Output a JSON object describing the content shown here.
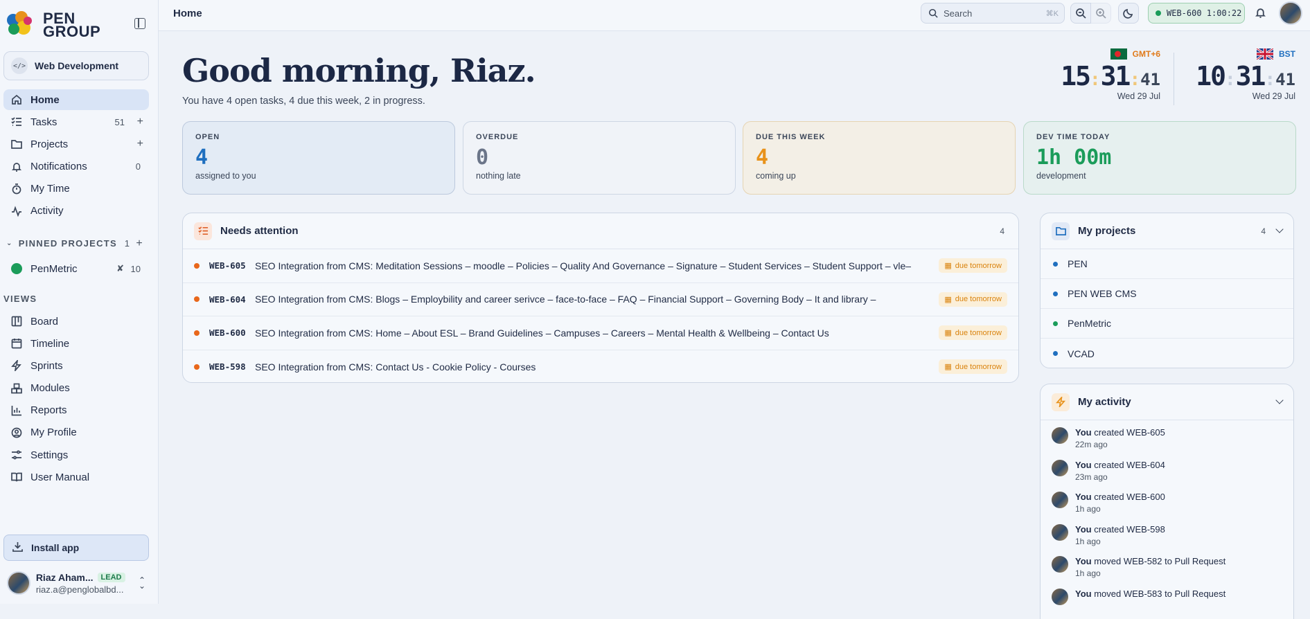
{
  "brand": {
    "line1": "PEN",
    "line2": "GROUP"
  },
  "workspace": {
    "label": "Web Development",
    "icon": "code-icon"
  },
  "nav": {
    "home": "Home",
    "tasks": "Tasks",
    "tasks_count": "51",
    "projects": "Projects",
    "notifications": "Notifications",
    "notifications_count": "0",
    "my_time": "My Time",
    "activity": "Activity"
  },
  "pinned": {
    "heading": "PINNED PROJECTS",
    "count": "1",
    "project": "PenMetric",
    "project_count": "10",
    "project_color": "#1b9c5a"
  },
  "views": {
    "heading": "VIEWS",
    "items": [
      "Board",
      "Timeline",
      "Sprints",
      "Modules",
      "Reports",
      "My Profile",
      "Settings",
      "User Manual"
    ]
  },
  "install": {
    "label": "Install app"
  },
  "user": {
    "name": "Riaz Aham...",
    "badge": "LEAD",
    "email": "riaz.a@penglobalbd..."
  },
  "topbar": {
    "breadcrumb": "Home",
    "search_placeholder": "Search",
    "search_shortcut": "⌘K",
    "timer_label": "WEB-600 1:00:22"
  },
  "greeting": {
    "title": "Good morning, Riaz.",
    "subtitle": "You have 4 open tasks, 4 due this week, 2 in progress."
  },
  "clocks": [
    {
      "tz": "GMT+6",
      "hh": "15",
      "mm": "31",
      "ss": "41",
      "date": "Wed 29 Jul",
      "tz_color": "#e07a1a"
    },
    {
      "tz": "BST",
      "hh": "10",
      "mm": "31",
      "ss": "41",
      "date": "Wed 29 Jul",
      "tz_color": "#1f6fbf"
    }
  ],
  "stats": [
    {
      "label": "OPEN",
      "value": "4",
      "note": "assigned to you",
      "color": "#1f6fbf"
    },
    {
      "label": "OVERDUE",
      "value": "0",
      "note": "nothing late",
      "color": "#6b7589"
    },
    {
      "label": "DUE THIS WEEK",
      "value": "4",
      "note": "coming up",
      "color": "#e8921b"
    },
    {
      "label": "DEV TIME TODAY",
      "value": "1h 00m",
      "note": "development",
      "color": "#1b9c5a"
    }
  ],
  "attention": {
    "title": "Needs attention",
    "count": "4",
    "rows": [
      {
        "key": "WEB-605",
        "title": "SEO Integration from CMS: Meditation Sessions – moodle – Policies – Quality And Governance – Signature – Student Services – Student Support – vle–",
        "due": "due tomorrow"
      },
      {
        "key": "WEB-604",
        "title": "SEO Integration from CMS: Blogs – Employbility and career serivce – face-to-face – FAQ – Financial Support – Governing Body – It and library –",
        "due": "due tomorrow"
      },
      {
        "key": "WEB-600",
        "title": "SEO Integration from CMS: Home – About ESL – Brand Guidelines – Campuses – Careers – Mental Health & Wellbeing – Contact Us",
        "due": "due tomorrow"
      },
      {
        "key": "WEB-598",
        "title": "SEO Integration from CMS: Contact Us - Cookie Policy - Courses",
        "due": "due tomorrow"
      }
    ]
  },
  "my_projects": {
    "title": "My projects",
    "count": "4",
    "items": [
      {
        "name": "PEN",
        "color": "#1f6fbf"
      },
      {
        "name": "PEN WEB CMS",
        "color": "#1f6fbf"
      },
      {
        "name": "PenMetric",
        "color": "#1b9c5a"
      },
      {
        "name": "VCAD",
        "color": "#1f6fbf"
      }
    ]
  },
  "my_activity": {
    "title": "My activity",
    "items": [
      {
        "who": "You",
        "text": " created WEB-605",
        "time": "22m ago"
      },
      {
        "who": "You",
        "text": " created WEB-604",
        "time": "23m ago"
      },
      {
        "who": "You",
        "text": " created WEB-600",
        "time": "1h ago"
      },
      {
        "who": "You",
        "text": " created WEB-598",
        "time": "1h ago"
      },
      {
        "who": "You",
        "text": " moved WEB-582 to Pull Request",
        "time": "1h ago"
      },
      {
        "who": "You",
        "text": " moved WEB-583 to Pull Request",
        "time": ""
      }
    ]
  }
}
